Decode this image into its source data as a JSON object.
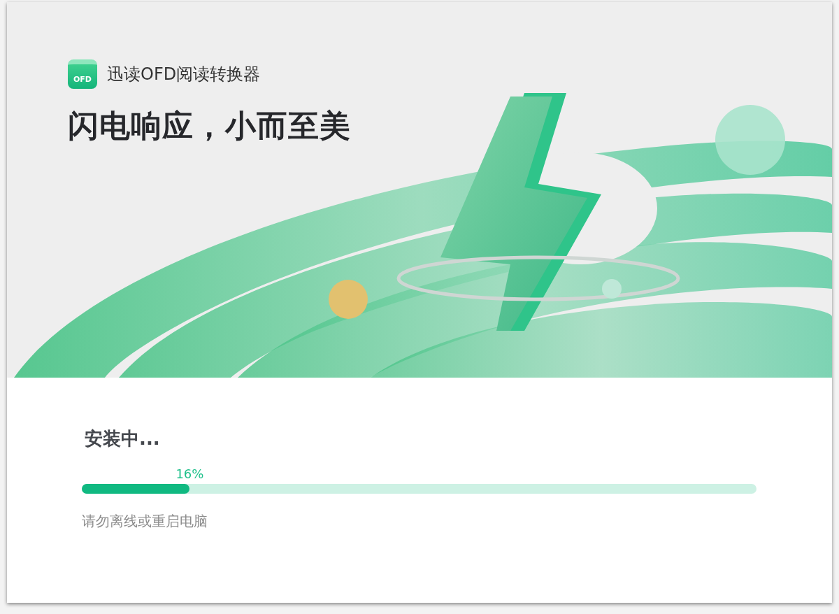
{
  "app": {
    "logo_text": "OFD",
    "name": "迅读OFD阅读转换器"
  },
  "banner": {
    "headline": "闪电响应，小而至美"
  },
  "install": {
    "status": "安装中...",
    "percent": "16%",
    "level": 0.16,
    "hint": "请勿离线或重启电脑"
  }
}
